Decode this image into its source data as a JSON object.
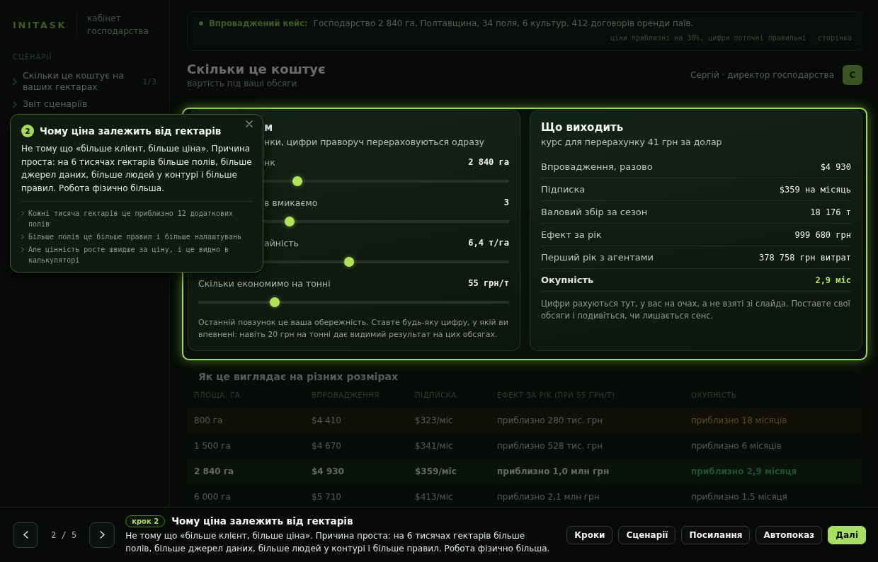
{
  "sidebar": {
    "logo": "INITASK",
    "subtitle": "кабінет господарства",
    "section_label": "СЦЕНАРІЇ",
    "items": [
      {
        "label": "Скільки це коштує на ваших гектарах",
        "count": "1/3"
      },
      {
        "label": "Звіт сценаріїв"
      }
    ]
  },
  "banner": {
    "label": "Впроваджений кейс:",
    "text": "Господарство 2 840 га, Полтавщина, 34 поля, 6 культур, 412 договорів оренди паїв.",
    "note": "ціни приблизні на 30%, цифри поточні правильні",
    "link": "сторінка"
  },
  "header": {
    "title": "Скільки це коштує",
    "subtitle": "вартість під ваші обсяги",
    "user": "Сергій · директор господарства",
    "avatar": "С"
  },
  "calculator": {
    "title": "м",
    "subtitle": "нки, цифри праворуч перераховуються одразу",
    "sliders": [
      {
        "label": "нк",
        "value": "2 840 га",
        "level": 0.32,
        "covered": true
      },
      {
        "label": "в вмикаємо",
        "value": "3",
        "level": 0.294,
        "covered": true
      },
      {
        "label": "айність",
        "value": "6,4 т/га",
        "level": 0.485,
        "covered": true
      },
      {
        "label": "Скільки економимо на тонні",
        "value": "55 грн/т",
        "level": 0.246,
        "covered": false
      }
    ],
    "note": "Останній повзунок це ваша обережність. Ставте будь-яку цифру, у якій ви впевнені: навіть 20 грн на тонні дає видимий результат на цих обсягах."
  },
  "results": {
    "title": "Що виходить",
    "subtitle": "курс для перерахунку 41 грн за долар",
    "rows": [
      {
        "label": "Впровадження, разово",
        "value": "$4 930",
        "kind": "line"
      },
      {
        "label": "Підписка",
        "value": "$359 на місяць",
        "kind": "line"
      },
      {
        "label": "Валовий збір за сезон",
        "value": "18 176 т",
        "kind": "line"
      },
      {
        "label": "Ефект за рік",
        "value": "999 680 грн",
        "kind": "line"
      },
      {
        "label": "Перший рік з агентами",
        "value": "378 758 грн витрат",
        "kind": "line"
      },
      {
        "label": "Окупність",
        "value": "2,9 міс",
        "kind": "total"
      }
    ],
    "note": "Цифри рахуються тут, у вас на очах, а не взяті зі слайда. Поставте свої обсяги і подивіться, чи лишається сенс."
  },
  "table": {
    "title": "Як це виглядає на різних розмірах",
    "columns": [
      "ПЛОЩА, ГА",
      "ВПРОВАДЖЕННЯ",
      "ПІДПИСКА",
      "ЕФЕКТ ЗА РІК (ПРИ 55 ГРН/Т)",
      "ОКУПНІСТЬ"
    ],
    "rows": [
      {
        "cells": [
          "800 га",
          "$4 410",
          "$323/міс",
          "приблизно 280 тис. грн",
          "приблизно 18 місяців"
        ],
        "kind": "warning",
        "selected": false
      },
      {
        "cells": [
          "1 500 га",
          "$4 670",
          "$341/міс",
          "приблизно 528 тис. грн",
          "приблизно 6 місяців"
        ],
        "kind": "plain",
        "selected": false
      },
      {
        "cells": [
          "2 840 га",
          "$4 930",
          "$359/міс",
          "приблизно 1,0 млн грн",
          "приблизно 2,9 місяця"
        ],
        "kind": "good",
        "selected": true
      },
      {
        "cells": [
          "6 000 га",
          "$5 710",
          "$413/міс",
          "приблизно 2,1 млн грн",
          "приблизно 1,5 місяця"
        ],
        "kind": "plain",
        "selected": false
      }
    ]
  },
  "tooltip": {
    "step": "2",
    "title": "Чому ціна залежить від гектарів",
    "text": "Не тому що «більше клієнт, більше ціна». Причина проста: на 6 тисячах гектарів більше полів, більше джерел даних, більше людей у контурі і більше правил. Робота фізично більша.",
    "points": [
      "Кожні тисяча гектарів це приблизно 12 додаткових полів",
      "Більше полів це більше правил і більше налаштувань",
      "Але цінність росте швидше за ціну, і це видно в калькуляторі"
    ]
  },
  "tour_bar": {
    "counter": "2 / 5",
    "badge": "крок 2",
    "title": "Чому ціна залежить від гектарів",
    "text": "Не тому що «більше клієнт, більше ціна». Причина проста: на 6 тисячах гектарів більше полів, більше джерел даних, більше людей у контурі і більше правил. Робота фізично більша.",
    "buttons": [
      {
        "label": "Кроки",
        "kind": "secondary"
      },
      {
        "label": "Сценарії",
        "kind": "secondary"
      },
      {
        "label": "Посилання",
        "kind": "secondary"
      },
      {
        "label": "Автопоказ",
        "kind": "secondary"
      },
      {
        "label": "Далі",
        "kind": "primary"
      }
    ]
  }
}
